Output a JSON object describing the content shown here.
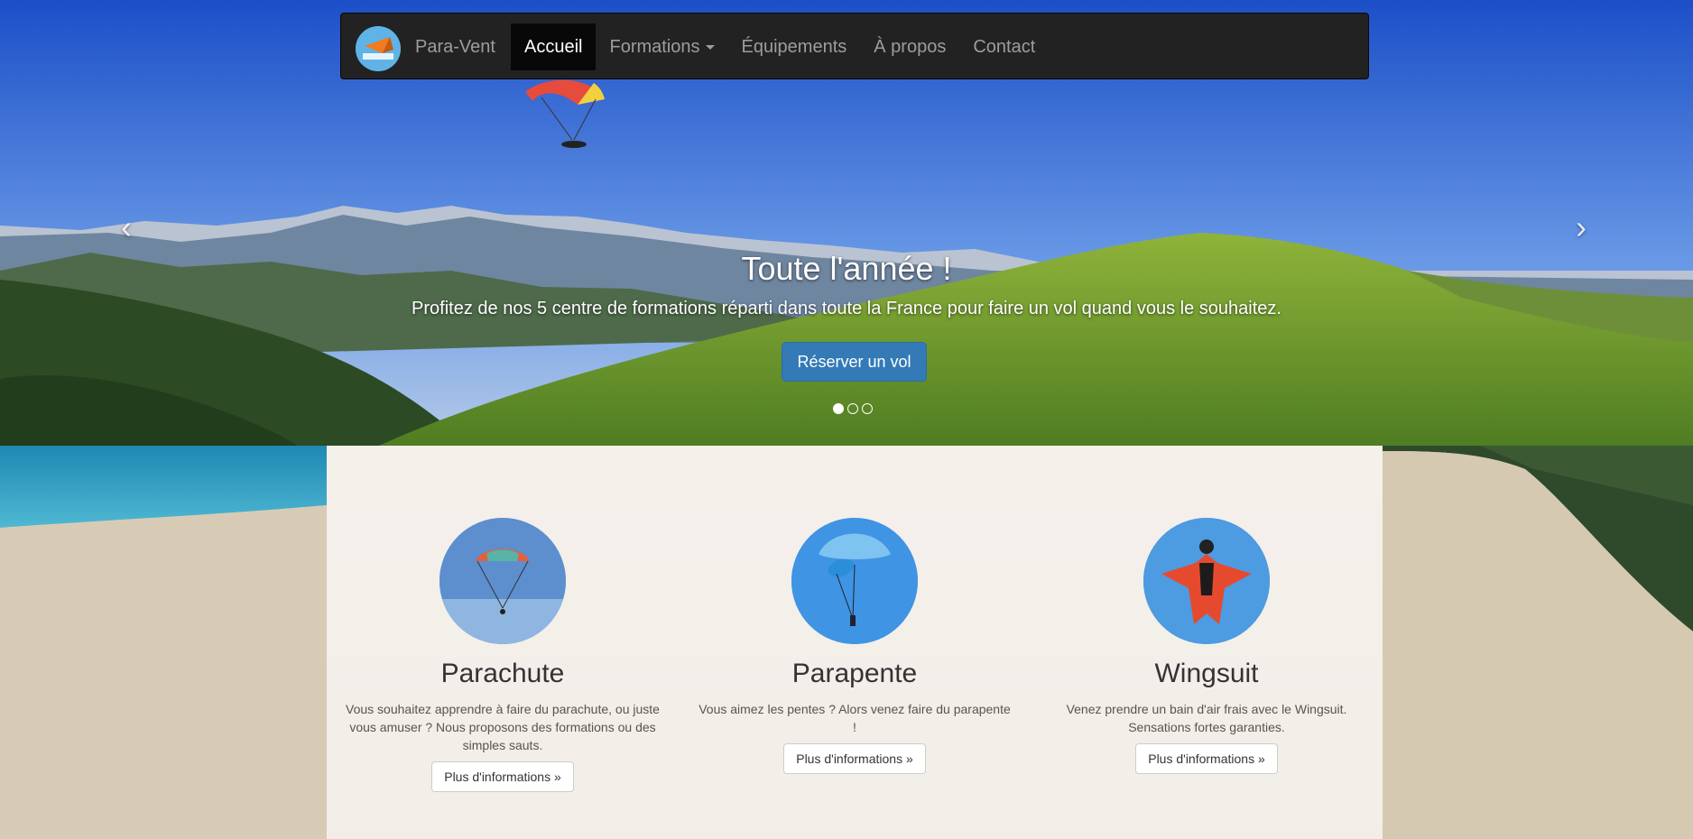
{
  "navbar": {
    "brand": "Para-Vent",
    "logo_text": "PARA-VENT",
    "items": [
      {
        "label": "Accueil"
      },
      {
        "label": "Formations"
      },
      {
        "label": "Équipements"
      },
      {
        "label": "À propos"
      },
      {
        "label": "Contact"
      }
    ]
  },
  "carousel": {
    "title": "Toute l'année !",
    "text": "Profitez de nos 5 centre de formations réparti dans toute la France pour faire un vol quand vous le souhaitez.",
    "button_label": "Réserver un vol",
    "prev_icon": "‹",
    "next_icon": "›",
    "slides": 3,
    "active_slide": 1
  },
  "features": [
    {
      "title": "Parachute",
      "text": "Vous souhaitez apprendre à faire du parachute, ou juste vous amuser ? Nous proposons des formations ou des simples sauts.",
      "button_label": "Plus d'informations »"
    },
    {
      "title": "Parapente",
      "text": "Vous aimez les pentes ? Alors venez faire du parapente !",
      "button_label": "Plus d'informations »"
    },
    {
      "title": "Wingsuit",
      "text": "Venez prendre un bain d'air frais avec le Wingsuit. Sensations fortes garanties.",
      "button_label": "Plus d'informations »"
    }
  ],
  "colors": {
    "navbar_bg": "#222222",
    "primary": "#337ab7",
    "link_muted": "#9d9d9d"
  }
}
